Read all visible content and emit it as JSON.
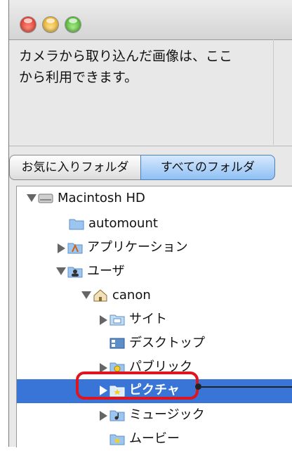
{
  "window": {
    "traffic_lights": [
      "close-button",
      "minimize-button",
      "zoom-button"
    ]
  },
  "info": {
    "text": "カメラから取り込んだ画像は、ここ\nから利用できます。"
  },
  "tabs": [
    {
      "label": "お気に入りフォルダ",
      "selected": false
    },
    {
      "label": "すべてのフォルダ",
      "selected": true
    }
  ],
  "tree": {
    "items": [
      {
        "label": "Macintosh HD",
        "icon": "hard-drive-icon",
        "expander": "down",
        "level": 0
      },
      {
        "label": "automount",
        "icon": "folder-icon",
        "expander": "none",
        "level": 1
      },
      {
        "label": "アプリケーション",
        "icon": "applications-folder-icon",
        "expander": "right",
        "level": 1
      },
      {
        "label": "ユーザ",
        "icon": "users-folder-icon",
        "expander": "down",
        "level": 1
      },
      {
        "label": "canon",
        "icon": "home-folder-icon",
        "expander": "down",
        "level": 2
      },
      {
        "label": "サイト",
        "icon": "sites-folder-icon",
        "expander": "right",
        "level": 3
      },
      {
        "label": "デスクトップ",
        "icon": "desktop-folder-icon",
        "expander": "none",
        "level": 3
      },
      {
        "label": "パブリック",
        "icon": "public-folder-icon",
        "expander": "right",
        "level": 3
      },
      {
        "label": "ピクチャ",
        "icon": "pictures-folder-icon",
        "expander": "right",
        "level": 3,
        "selected": true
      },
      {
        "label": "ミュージック",
        "icon": "music-folder-icon",
        "expander": "right",
        "level": 3
      },
      {
        "label": "ムービー",
        "icon": "movies-folder-icon",
        "expander": "none",
        "level": 3
      }
    ]
  },
  "colors": {
    "selection": "#3875d7",
    "callout": "#e0141e"
  }
}
